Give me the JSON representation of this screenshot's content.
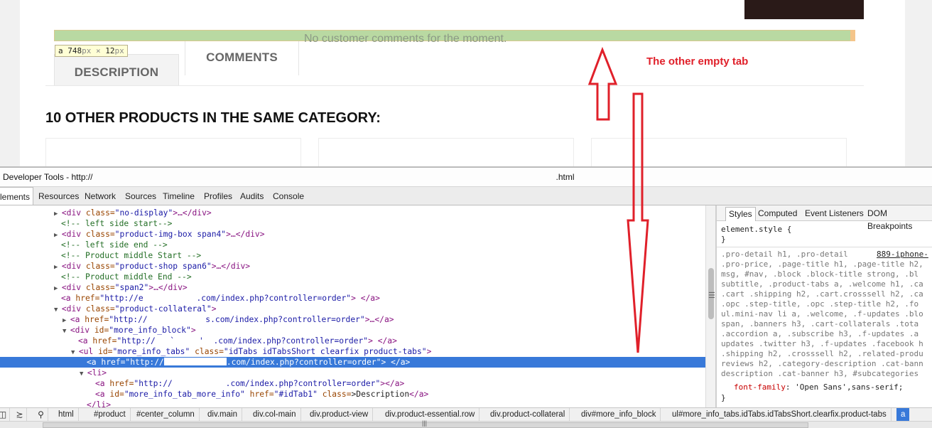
{
  "website": {
    "highlight_text": "No customer comments for the moment.",
    "size_badge": {
      "tag": "a",
      "width": "748",
      "height": "12",
      "unit": "px",
      "times": "×"
    },
    "tabs": [
      {
        "label": "DESCRIPTION"
      },
      {
        "label": "COMMENTS"
      }
    ],
    "section_heading": "10 OTHER PRODUCTS IN THE SAME CATEGORY:"
  },
  "annotation": {
    "text": "The other empty tab",
    "color": "#e0202a"
  },
  "devtools": {
    "title_prefix": "Developer Tools - http://",
    "title_suffix": ".html",
    "tabs": [
      "lements",
      "Resources",
      "Network",
      "Sources",
      "Timeline",
      "Profiles",
      "Audits",
      "Console"
    ],
    "dom": [
      {
        "ind": 76,
        "tri": "▶",
        "t": "<div ",
        "a": "class=",
        "v": "\"no-display\"",
        "e": ">…</div>"
      },
      {
        "ind": 86,
        "c": "<!-- left side start-->"
      },
      {
        "ind": 76,
        "tri": "▶",
        "t": "<div ",
        "a": "class=",
        "v": "\"product-img-box span4\"",
        "e": ">…</div>"
      },
      {
        "ind": 86,
        "c": "<!-- left side end -->"
      },
      {
        "ind": 86,
        "c": "<!-- Product middle Start -->"
      },
      {
        "ind": 76,
        "tri": "▶",
        "t": "<div ",
        "a": "class=",
        "v": "\"product-shop span6\"",
        "e": ">…</div>"
      },
      {
        "ind": 86,
        "c": "<!-- Product middle End -->"
      },
      {
        "ind": 76,
        "tri": "▶",
        "t": "<div ",
        "a": "class=",
        "v": "\"span2\"",
        "e": ">…</div>"
      },
      {
        "ind": 86,
        "t": "<a ",
        "a": "href=",
        "v": "\"http://e           .com/index.php?controller=order\"",
        "e": "> </a>"
      },
      {
        "ind": 76,
        "tri": "▼",
        "t": "<div ",
        "a": "class=",
        "v": "\"product-collateral\"",
        "e": ">"
      },
      {
        "ind": 88,
        "tri": "▶",
        "t": "<a ",
        "a": "href=",
        "v": "\"http://            s.com/index.php?controller=order\"",
        "e": ">…</a>"
      },
      {
        "ind": 88,
        "tri": "▼",
        "t": "<div ",
        "a": "id=",
        "v": "\"more_info_block\"",
        "e": ">"
      },
      {
        "ind": 110,
        "t": "<a ",
        "a": "href=",
        "v": "\"http://   `     '  .com/index.php?controller=order\"",
        "e": "> </a>"
      },
      {
        "ind": 100,
        "tri": "▼",
        "t": "<ul ",
        "a": "id=",
        "v": "\"more_info_tabs\" ",
        "a2": "class=",
        "v2": "\"idTabs idTabsShort clearfix product-tabs\"",
        "e": ">"
      },
      {
        "ind": 122,
        "sel": true,
        "t": "<a ",
        "a": "href=",
        "v": "\"http://",
        "redact": true,
        "v3": ".com/index.php?controller=order\"",
        "e": "> </a>"
      },
      {
        "ind": 112,
        "tri": "▼",
        "t": "<li>"
      },
      {
        "ind": 134,
        "t": "<a ",
        "a": "href=",
        "v": "\"http://           .com/index.php?controller=order\"",
        "e": "></a>"
      },
      {
        "ind": 134,
        "t": "<a ",
        "a": "id=",
        "v": "\"more_info_tab_more_info\" ",
        "a2": "href=",
        "v2": "\"#idTab1\" ",
        "a3": "class=",
        "x": ">Description",
        "e": "</a>"
      },
      {
        "ind": 122,
        "t": "</li>"
      }
    ],
    "styles_tabs": [
      "Styles",
      "Computed",
      "Event Listeners",
      "DOM Breakpoints"
    ],
    "element_style": [
      "element.style {",
      "}"
    ],
    "style_source": "889-iphone-",
    "style_lines": [
      ".pro-detail h1, .pro-detail",
      ".pro-price, .page-title h1, .page-title h2,",
      "msg, #nav, .block .block-title strong, .bl",
      "subtitle, .product-tabs a, .welcome h1, .ca",
      ".cart .shipping h2, .cart.crosssell h2, .ca",
      ".opc .step-title, .opc .step-title h2, .fo",
      "ul.mini-nav li a, .welcome, .f-updates .blo",
      "span, .banners h3, .cart-collaterals .tota",
      ".accordion a, .subscribe h3, .f-updates .a",
      "updates .twitter h3, .f-updates .facebook h",
      ".shipping h2, .crosssell h2, .related-produ",
      "reviews h2, .category-description .cat-bann",
      "description .cat-banner h3, #subcategories"
    ],
    "font_prop": "font-family",
    "font_value": "'Open Sans',sans-serif;",
    "close_brace": "}",
    "breadcrumbs": [
      "html",
      "#product",
      "#center_column",
      "div.main",
      "div.col-main",
      "div.product-view",
      "div.product-essential.row",
      "div.product-collateral",
      "div#more_info_block",
      "ul#more_info_tabs.idTabs.idTabsShort.clearfix.product-tabs",
      "a"
    ]
  }
}
